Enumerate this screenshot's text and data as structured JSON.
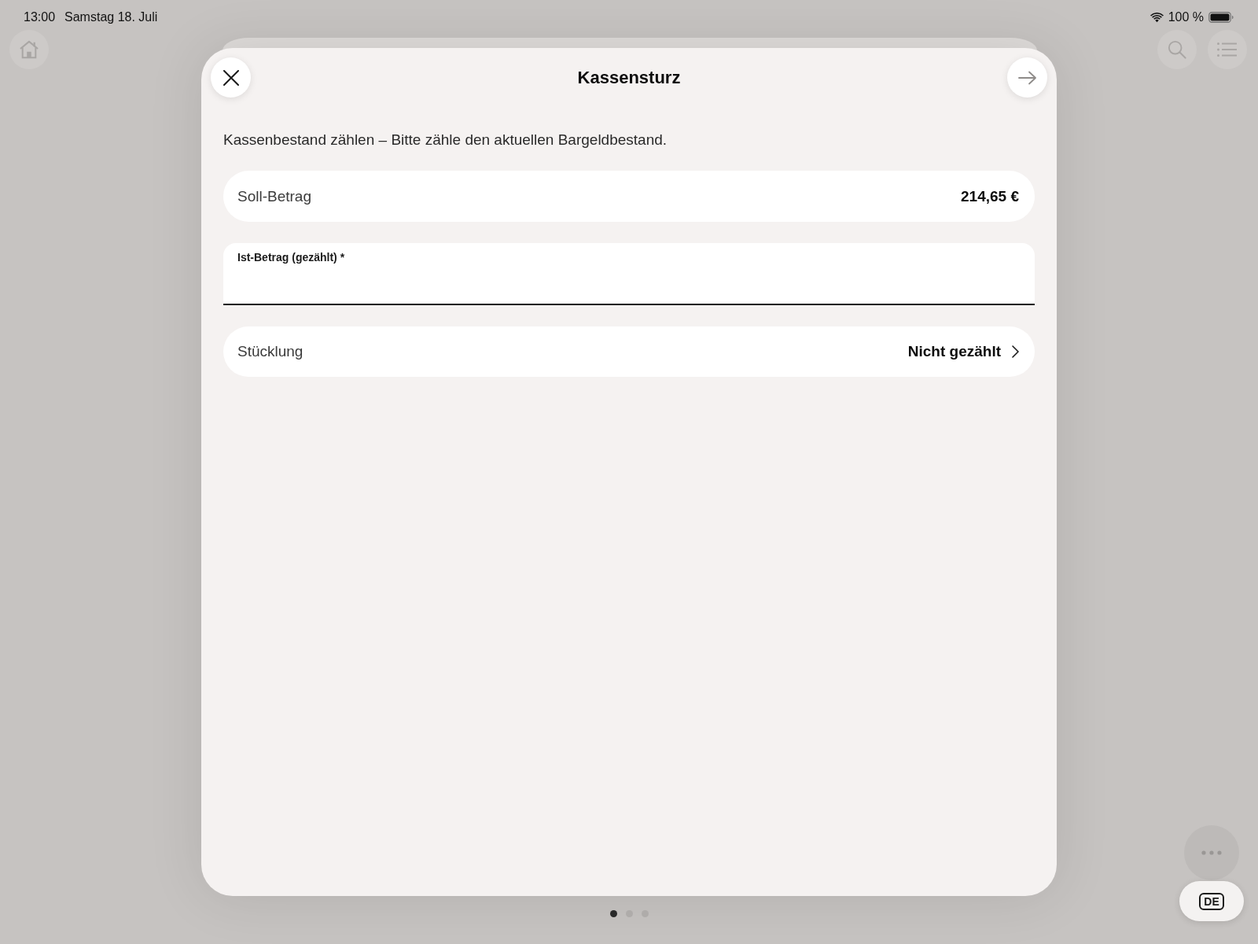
{
  "status_bar": {
    "time": "13:00",
    "date": "Samstag 18. Juli",
    "battery": "100 %"
  },
  "dialog": {
    "title": "Kassensturz",
    "next_button": {
      "disabled": true
    },
    "description": "Kassenbestand zählen – Bitte zähle den aktuellen Bargeldbestand.",
    "rows": [
      {
        "kind": "amount",
        "label": "Soll-Betrag",
        "value": "214,65 €"
      },
      {
        "kind": "input",
        "label": "Ist-Betrag (gezählt) *"
      },
      {
        "kind": "link",
        "label": "Stücklung",
        "value": "Nicht gezählt"
      }
    ]
  },
  "page_indicator": [
    {
      "selected": true
    },
    {
      "selected": false
    },
    {
      "selected": false
    }
  ],
  "language_button": {
    "label": "DE"
  }
}
